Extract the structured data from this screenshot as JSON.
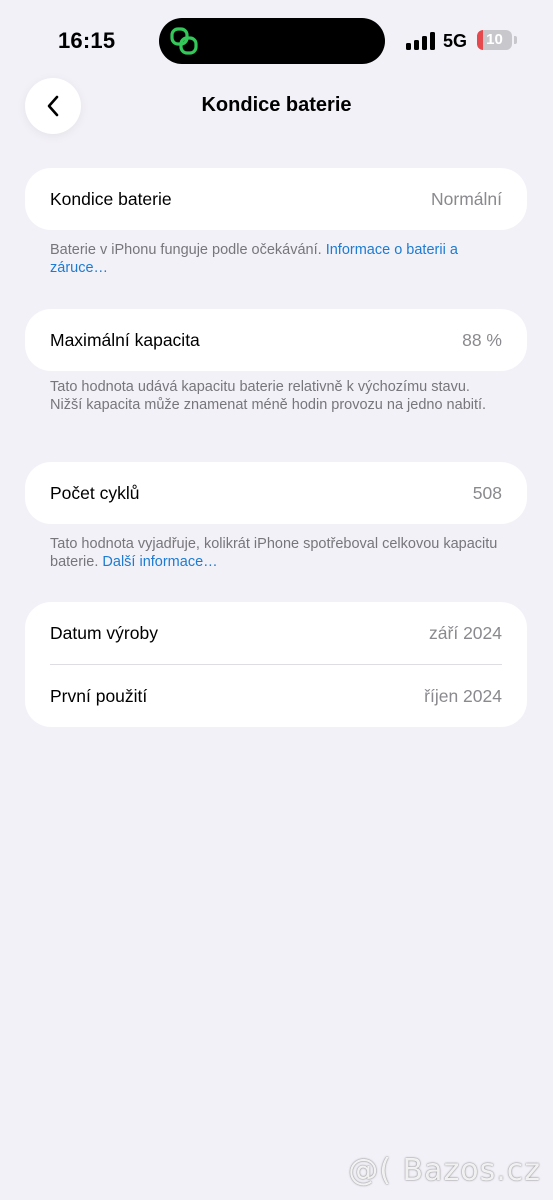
{
  "status_bar": {
    "time": "16:15",
    "network": "5G",
    "battery_level": "10",
    "battery_fraction": 0.1,
    "island_icon": "chain-link-icon",
    "accent": "#34c759"
  },
  "nav": {
    "back_icon": "chevron-left-icon",
    "title": "Kondice baterie"
  },
  "battery_health": {
    "label": "Kondice baterie",
    "value": "Normální",
    "note_text": "Baterie v iPhonu funguje podle očekávání. ",
    "note_link": "Informace o baterii a záruce…"
  },
  "max_capacity": {
    "label": "Maximální kapacita",
    "value": "88 %",
    "note_text": "Tato hodnota udává kapacitu baterie relativně k výchozímu stavu. Nižší kapacita může znamenat méně hodin provozu na jedno nabití."
  },
  "cycle_count": {
    "label": "Počet cyklů",
    "value": "508",
    "note_text": "Tato hodnota vyjadřuje, kolikrát iPhone spotřeboval celkovou kapacitu baterie. ",
    "note_link": "Další informace…"
  },
  "dates": {
    "manufacture_label": "Datum výroby",
    "manufacture_value": "září 2024",
    "first_use_label": "První použití",
    "first_use_value": "říjen 2024"
  },
  "watermark": "@( Bazos.cz",
  "colors": {
    "background": "#f2f1f7",
    "card": "#ffffff",
    "link": "#1d7bd3",
    "secondary_text": "#8a8a8e",
    "battery_low": "#e5484d"
  }
}
